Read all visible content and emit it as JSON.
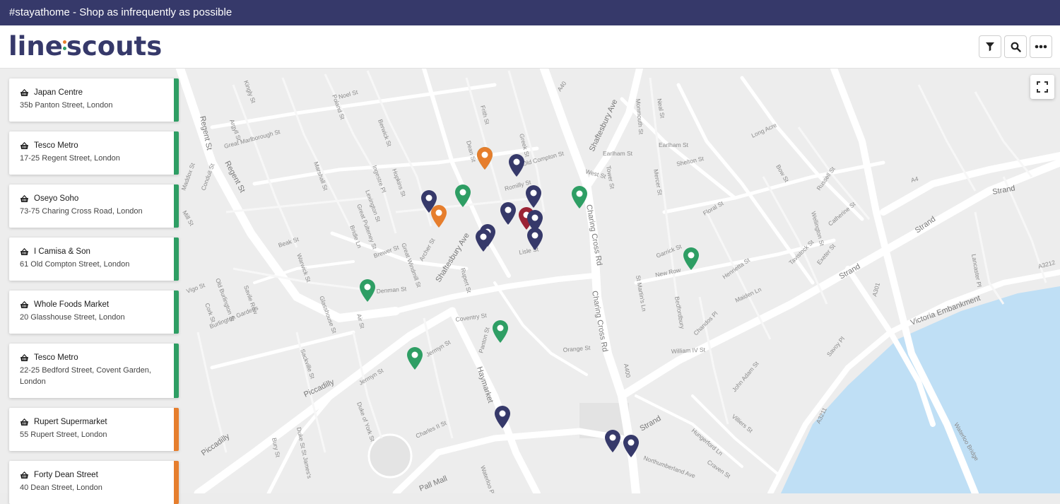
{
  "banner": {
    "text": "#stayathome - Shop as infrequently as possible"
  },
  "brand": {
    "left": "line",
    "right": "scouts"
  },
  "header_buttons": [
    {
      "icon": "filter-icon"
    },
    {
      "icon": "search-icon"
    },
    {
      "icon": "more-icon"
    }
  ],
  "map": {
    "fullscreen_icon": "fullscreen-icon",
    "street_labels": [
      "Regent St",
      "Maddox St",
      "Mill St",
      "Conduit St",
      "Argyll St",
      "Great Marlborough St",
      "Noel St",
      "Berwick St",
      "Poland St",
      "Marshall St",
      "Ingestre Pl",
      "Hopkins St",
      "Lexington St",
      "Great Pulteney St",
      "Bridle Ln",
      "Beak St",
      "Warwick St",
      "Brewer St",
      "Great Windmill St",
      "Archer St",
      "Shaftesbury Ave",
      "Rupert St",
      "Denman St",
      "Air St",
      "Glasshouse St",
      "Vigo St",
      "Burlington Gardens",
      "Savile Row",
      "Old Burlington St",
      "Cork St",
      "Sackville St",
      "Piccadilly",
      "Jermyn St",
      "Duke of York St",
      "Charles II St",
      "Haymarket",
      "Coventry St",
      "Panton St",
      "Orange St",
      "Lisle St",
      "Dean St",
      "Frith St",
      "Greek St",
      "Old Compton St",
      "Romilly St",
      "Charing Cross Rd",
      "A400",
      "Shaftesbury Ave",
      "Earlham St",
      "Monmouth St",
      "Neal St",
      "Shelton St",
      "Mercer St",
      "Tower St",
      "West St",
      "Long Acre",
      "Floral St",
      "Garrick St",
      "New Row",
      "Henrietta St",
      "Maiden Ln",
      "Bedfordbury",
      "Chandos Pl",
      "William IV St",
      "St Martin's Ln",
      "Strand",
      "A4",
      "Bow St",
      "Russell St",
      "Wellington St",
      "Catherine St",
      "Exeter St",
      "Tavistock St",
      "Savoy St",
      "Lancaster Pl",
      "Victoria Embankment",
      "A3211",
      "A301",
      "Waterloo Bridge",
      "Villiers St",
      "Hungerford Ln",
      "Northumberland Ave",
      "Craven St",
      "John Adam St",
      "Pall Mall",
      "Duke St St James's",
      "Bury St",
      "Waterloo Pl",
      "A40",
      "A3212",
      "Kingly St"
    ],
    "markers": [
      {
        "color": "#36396a"
      },
      {
        "color": "#e67e2d"
      },
      {
        "color": "#2e9e64"
      },
      {
        "color": "#36396a"
      },
      {
        "color": "#2e9e64"
      },
      {
        "color": "#36396a"
      },
      {
        "color": "#36396a"
      },
      {
        "color": "#9b2335"
      },
      {
        "color": "#36396a"
      },
      {
        "color": "#36396a"
      },
      {
        "color": "#36396a"
      },
      {
        "color": "#36396a"
      },
      {
        "color": "#e67e2d"
      },
      {
        "color": "#2e9e64"
      },
      {
        "color": "#2e9e64"
      },
      {
        "color": "#2e9e64"
      },
      {
        "color": "#2e9e64"
      },
      {
        "color": "#2e9e64"
      },
      {
        "color": "#36396a"
      },
      {
        "color": "#36396a"
      },
      {
        "color": "#36396a"
      }
    ]
  },
  "stores": [
    {
      "name": "Japan Centre",
      "address": "35b Panton Street, London",
      "status": "green",
      "icon": "basket-icon"
    },
    {
      "name": "Tesco Metro",
      "address": "17-25 Regent Street, London",
      "status": "green",
      "icon": "basket-icon"
    },
    {
      "name": "Oseyo Soho",
      "address": "73-75 Charing Cross Road, London",
      "status": "green",
      "icon": "basket-icon"
    },
    {
      "name": "I Camisa & Son",
      "address": "61 Old Compton Street, London",
      "status": "green",
      "icon": "basket-icon"
    },
    {
      "name": "Whole Foods Market",
      "address": "20 Glasshouse Street, London",
      "status": "green",
      "icon": "basket-icon"
    },
    {
      "name": "Tesco Metro",
      "address": "22-25 Bedford Street, Covent Garden, London",
      "status": "green",
      "icon": "basket-icon"
    },
    {
      "name": "Rupert Supermarket",
      "address": "55 Rupert Street, London",
      "status": "orange",
      "icon": "basket-icon"
    },
    {
      "name": "Forty Dean Street",
      "address": "40 Dean Street, London",
      "status": "orange",
      "icon": "basket-icon"
    }
  ],
  "colors": {
    "green": "#2e9e64",
    "orange": "#e67e2d",
    "navy": "#36396a",
    "red": "#9b2335",
    "water": "#bfdff5"
  }
}
